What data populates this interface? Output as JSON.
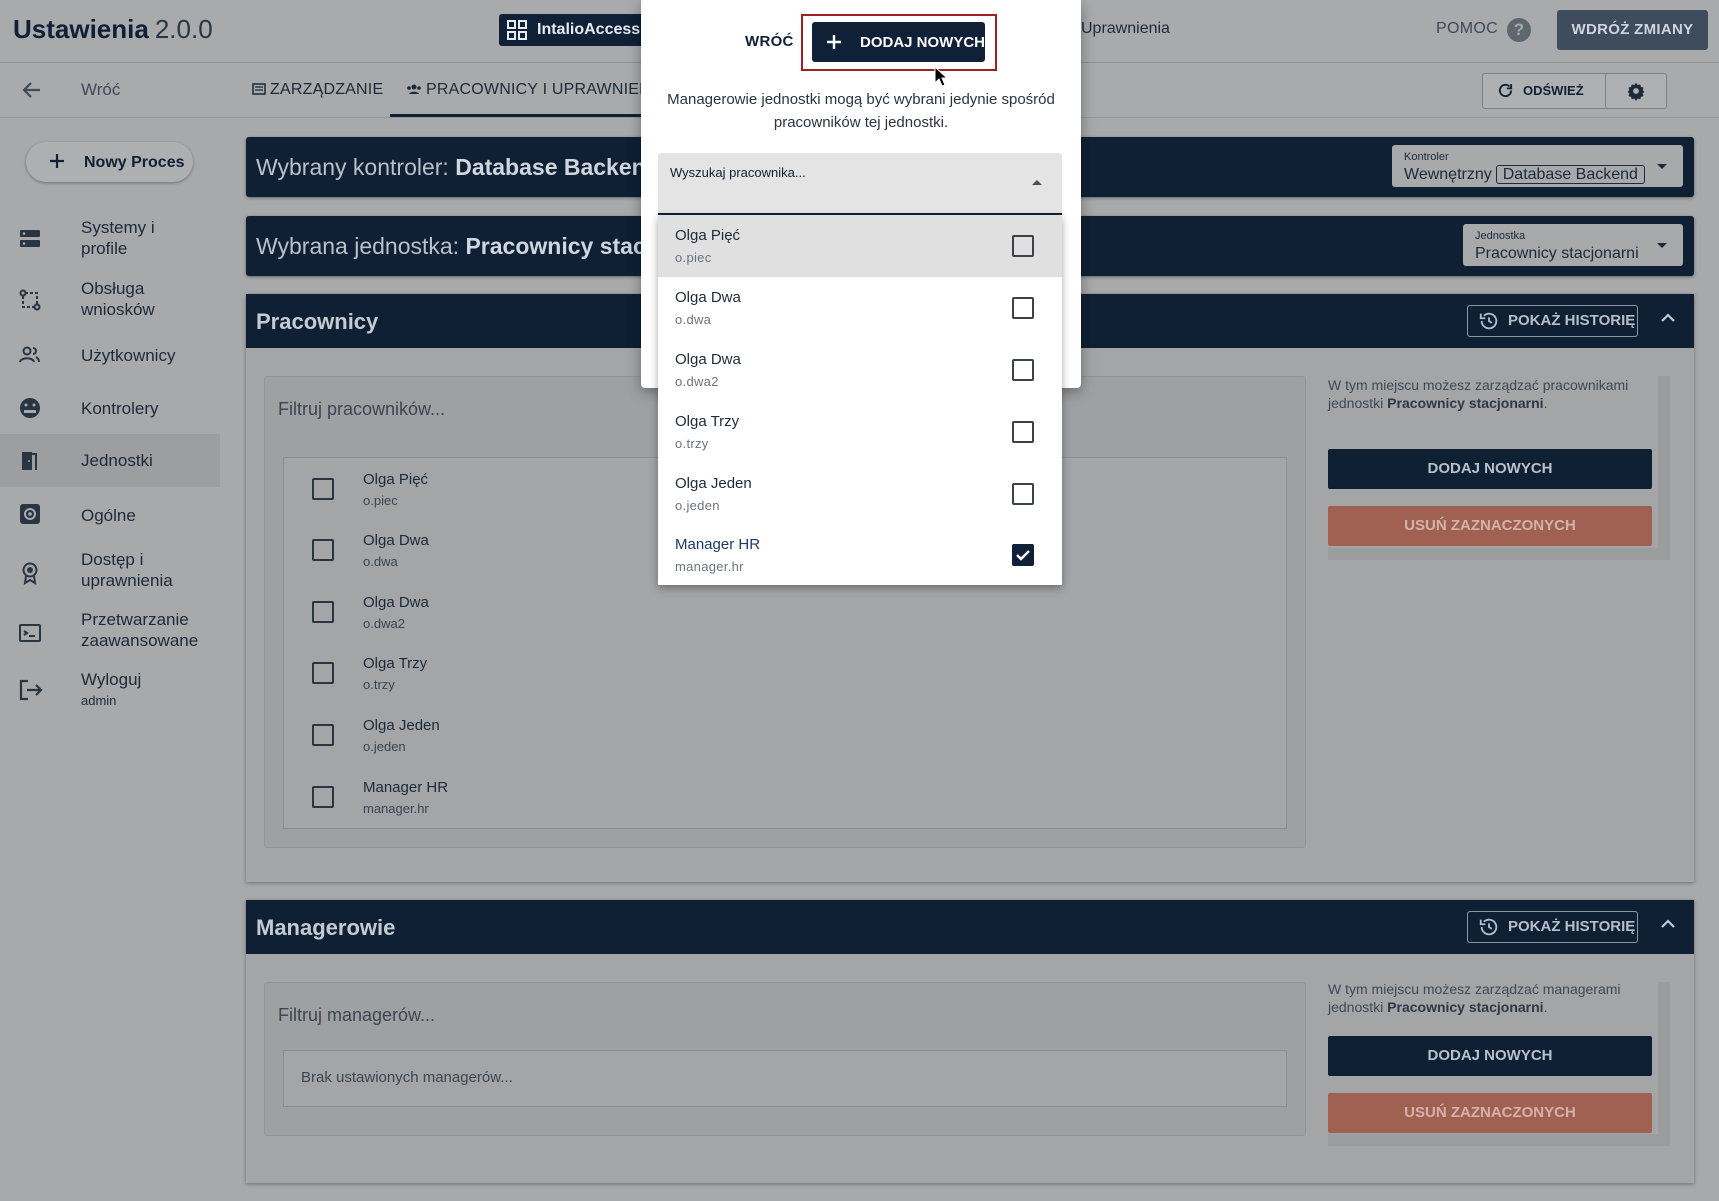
{
  "app": {
    "title": "Ustawienia",
    "version": "2.0.0"
  },
  "topbar": {
    "app_switch_label": "IntalioAccessM",
    "crumb": "Uprawnienia",
    "help_label": "POMOC",
    "help_icon": "?",
    "deploy_label": "WDRÓŻ ZMIANY"
  },
  "subbar": {
    "back_label": "Wróć",
    "tabs": [
      {
        "label": "ZARZĄDZANIE"
      },
      {
        "label": "PRACOWNICY I UPRAWNIENIA"
      }
    ],
    "refresh_label": "ODŚWIEŻ"
  },
  "sidebar": {
    "new_process_label": "Nowy Proces",
    "items": [
      {
        "label": "Systemy i profile",
        "icon": "storage-icon"
      },
      {
        "label": "Obsługa wniosków",
        "icon": "workflow-icon"
      },
      {
        "label": "Użytkownicy",
        "icon": "users-icon"
      },
      {
        "label": "Kontrolery",
        "icon": "controller-icon"
      },
      {
        "label": "Jednostki",
        "icon": "door-icon"
      },
      {
        "label": "Ogólne",
        "icon": "settings-icon"
      },
      {
        "label": "Dostęp i uprawnienia",
        "icon": "badge-icon"
      },
      {
        "label": "Przetwarzanie zaawansowane",
        "icon": "terminal-icon"
      },
      {
        "label": "Wyloguj",
        "sub": "admin",
        "icon": "logout-icon"
      }
    ]
  },
  "controller_banner": {
    "prefix": "Wybrany kontroler:",
    "name": "Database Backend",
    "select_label": "Kontroler",
    "select_value_prefix": "Wewnętrzny",
    "select_value_chip": "Database Backend"
  },
  "unit_banner": {
    "prefix": "Wybrana jednostka:",
    "name": "Pracownicy stacjo",
    "select_label": "Jednostka",
    "select_value": "Pracownicy stacjonarni"
  },
  "workers_panel": {
    "title": "Pracownicy",
    "history_label": "POKAŻ HISTORIĘ",
    "filter_placeholder": "Filtruj pracowników...",
    "rows": [
      {
        "name": "Olga Pięć",
        "login": "o.piec"
      },
      {
        "name": "Olga Dwa",
        "login": "o.dwa"
      },
      {
        "name": "Olga Dwa",
        "login": "o.dwa2"
      },
      {
        "name": "Olga Trzy",
        "login": "o.trzy"
      },
      {
        "name": "Olga Jeden",
        "login": "o.jeden"
      },
      {
        "name": "Manager HR",
        "login": "manager.hr"
      }
    ],
    "help_pre": "W tym miejscu możesz zarządzać pracownikami jednostki",
    "help_unit": "Pracownicy stacjonarni",
    "add_label": "DODAJ NOWYCH",
    "delete_label": "USUŃ ZAZNACZONYCH"
  },
  "managers_panel": {
    "title": "Managerowie",
    "history_label": "POKAŻ HISTORIĘ",
    "filter_placeholder": "Filtruj managerów...",
    "empty_label": "Brak ustawionych managerów...",
    "help_pre": "W tym miejscu możesz zarządzać managerami jednostki",
    "help_unit": "Pracownicy stacjonarni",
    "add_label": "DODAJ NOWYCH",
    "delete_label": "USUŃ ZAZNACZONYCH"
  },
  "modal": {
    "back_label": "WRÓĆ",
    "add_label": "DODAJ NOWYCH",
    "info": "Managerowie jednostki mogą być wybrani jedynie spośród pracowników tej jednostki.",
    "search_label": "Wyszukaj pracownika...",
    "options": [
      {
        "name": "Olga Pięć",
        "login": "o.piec",
        "checked": false
      },
      {
        "name": "Olga Dwa",
        "login": "o.dwa",
        "checked": false
      },
      {
        "name": "Olga Dwa",
        "login": "o.dwa2",
        "checked": false
      },
      {
        "name": "Olga Trzy",
        "login": "o.trzy",
        "checked": false
      },
      {
        "name": "Olga Jeden",
        "login": "o.jeden",
        "checked": false
      },
      {
        "name": "Manager HR",
        "login": "manager.hr",
        "checked": true
      }
    ]
  },
  "colors": {
    "primary": "#102036",
    "danger": "#a06153",
    "highlight_outline": "#9b2222"
  }
}
